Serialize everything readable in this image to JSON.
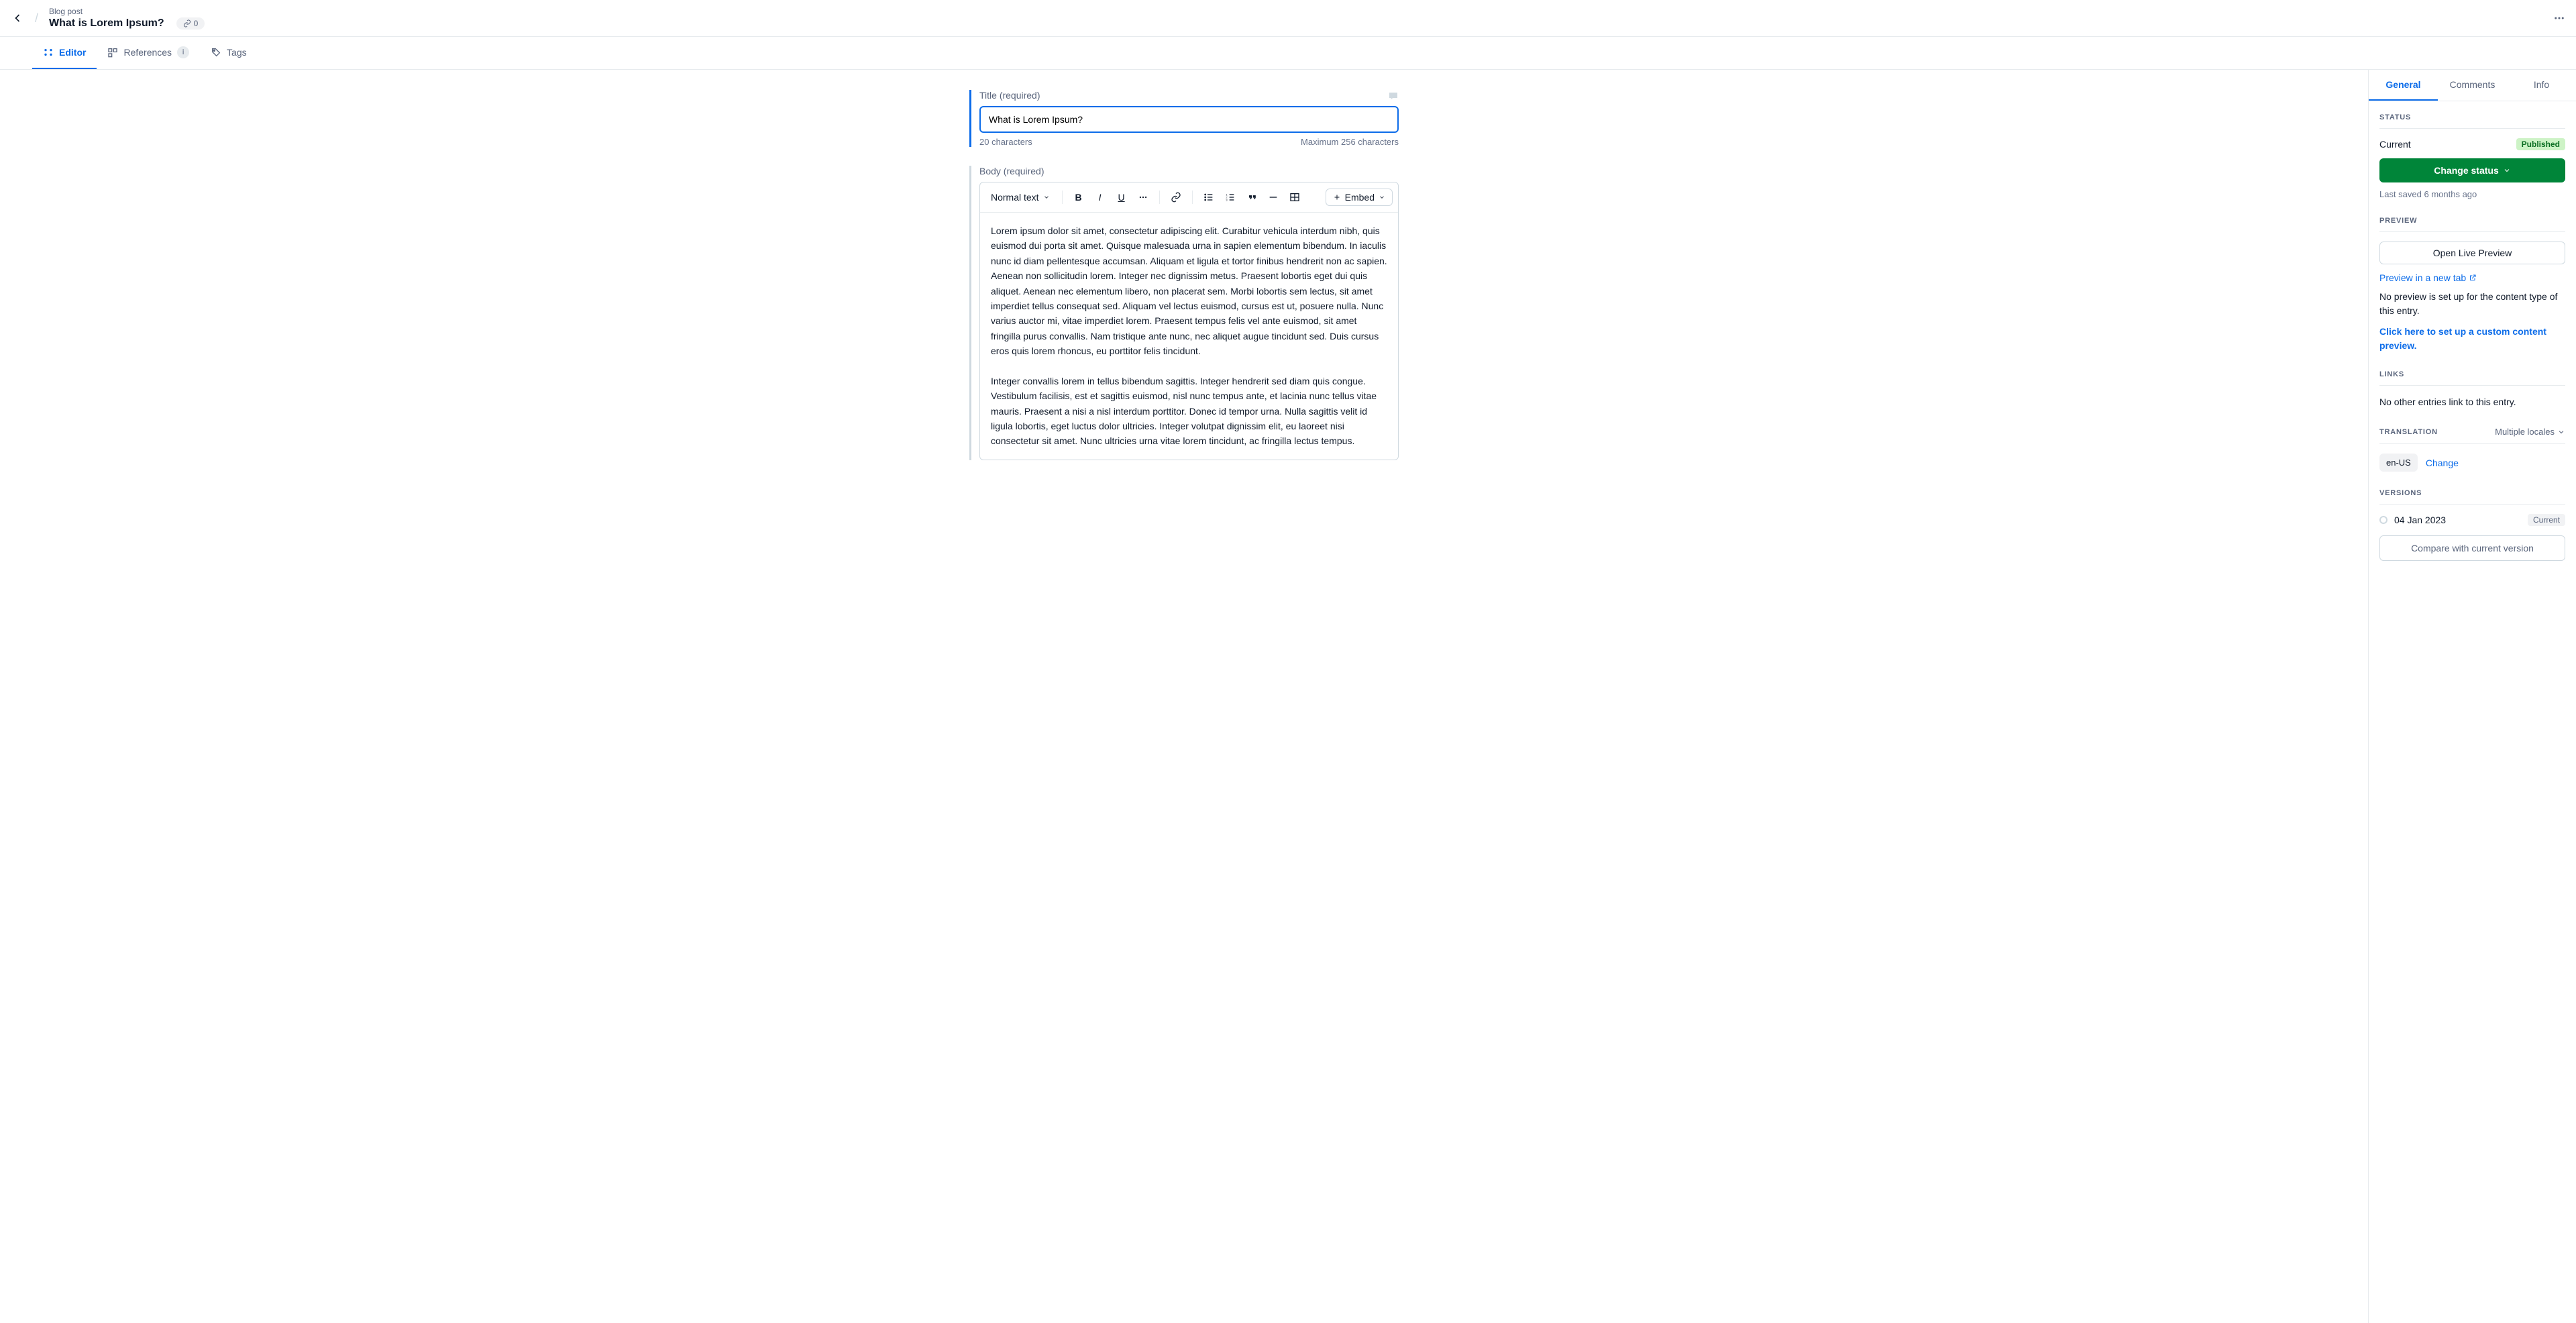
{
  "breadcrumb": {
    "type": "Blog post",
    "title": "What is Lorem Ipsum?"
  },
  "link_count": "0",
  "tabs": {
    "editor": "Editor",
    "references": "References",
    "references_badge": "i",
    "tags": "Tags"
  },
  "title_field": {
    "label": "Title (required)",
    "value": "What is Lorem Ipsum?",
    "count": "20 characters",
    "max": "Maximum 256 characters"
  },
  "body_field": {
    "label": "Body (required)",
    "text_style": "Normal text",
    "embed": "Embed",
    "content": "Lorem ipsum dolor sit amet, consectetur adipiscing elit. Curabitur vehicula interdum nibh, quis euismod dui porta sit amet. Quisque malesuada urna in sapien elementum bibendum. In iaculis nunc id diam pellentesque accumsan. Aliquam et ligula et tortor finibus hendrerit non ac sapien. Aenean non sollicitudin lorem. Integer nec dignissim metus. Praesent lobortis eget dui quis aliquet. Aenean nec elementum libero, non placerat sem. Morbi lobortis sem lectus, sit amet imperdiet tellus consequat sed. Aliquam vel lectus euismod, cursus est ut, posuere nulla. Nunc varius auctor mi, vitae imperdiet lorem. Praesent tempus felis vel ante euismod, sit amet fringilla purus convallis. Nam tristique ante nunc, nec aliquet augue tincidunt sed. Duis cursus eros quis lorem rhoncus, eu porttitor felis tincidunt.\n\nInteger convallis lorem in tellus bibendum sagittis. Integer hendrerit sed diam quis congue. Vestibulum facilisis, est et sagittis euismod, nisl nunc tempus ante, et lacinia nunc tellus vitae mauris. Praesent a nisi a nisl interdum porttitor. Donec id tempor urna. Nulla sagittis velit id ligula lobortis, eget luctus dolor ultricies. Integer volutpat dignissim elit, eu laoreet nisi consectetur sit amet. Nunc ultricies urna vitae lorem tincidunt, ac fringilla lectus tempus."
  },
  "side_tabs": {
    "general": "General",
    "comments": "Comments",
    "info": "Info"
  },
  "status": {
    "heading": "Status",
    "current_label": "Current",
    "badge": "Published",
    "change": "Change status",
    "last_saved": "Last saved 6 months ago"
  },
  "preview": {
    "heading": "Preview",
    "open": "Open Live Preview",
    "new_tab": "Preview in a new tab",
    "no_setup": "No preview is set up for the content type of this entry.",
    "setup_link": "Click here to set up a custom content preview."
  },
  "links": {
    "heading": "Links",
    "empty": "No other entries link to this entry."
  },
  "translation": {
    "heading": "Translation",
    "multiple": "Multiple locales",
    "locale": "en-US",
    "change": "Change"
  },
  "versions": {
    "heading": "Versions",
    "date": "04 Jan 2023",
    "current": "Current",
    "compare": "Compare with current version"
  }
}
